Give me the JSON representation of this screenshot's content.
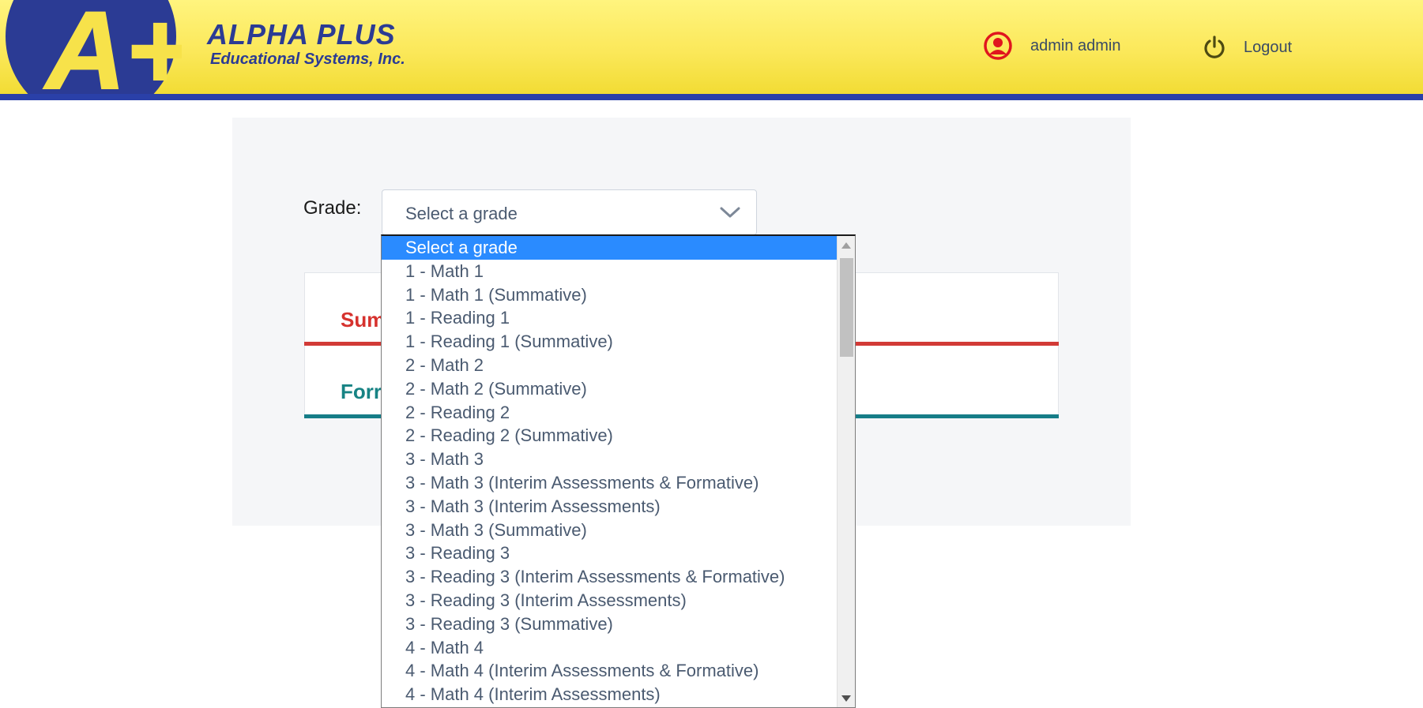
{
  "header": {
    "logo_mark": "A+",
    "brand_title": "ALPHA PLUS",
    "brand_subtitle": "Educational Systems, Inc.",
    "user_icon": "user-circle-icon",
    "user_name": "admin admin",
    "logout_icon": "power-icon",
    "logout_label": "Logout"
  },
  "form": {
    "grade_label": "Grade:",
    "grade_value": "Select a grade"
  },
  "tabs": {
    "summative_label": "Sum",
    "formative_label": "Forr"
  },
  "dropdown": {
    "options": [
      "Select a grade",
      "1 - Math 1",
      "1 - Math 1 (Summative)",
      "1 - Reading 1",
      "1 - Reading 1 (Summative)",
      "2 - Math 2",
      "2 - Math 2 (Summative)",
      "2 - Reading 2",
      "2 - Reading 2 (Summative)",
      "3 - Math 3",
      "3 - Math 3 (Interim Assessments & Formative)",
      "3 - Math 3 (Interim Assessments)",
      "3 - Math 3 (Summative)",
      "3 - Reading 3",
      "3 - Reading 3 (Interim Assessments & Formative)",
      "3 - Reading 3 (Interim Assessments)",
      "3 - Reading 3 (Summative)",
      "4 - Math 4",
      "4 - Math 4 (Interim Assessments & Formative)",
      "4 - Math 4 (Interim Assessments)"
    ],
    "selected_index": 0
  },
  "colors": {
    "header_yellow": "#fbe85a",
    "header_blue": "#2a40a8",
    "summative_red": "#d23a36",
    "formative_teal": "#167d88",
    "selected_blue": "#2a8bff"
  }
}
